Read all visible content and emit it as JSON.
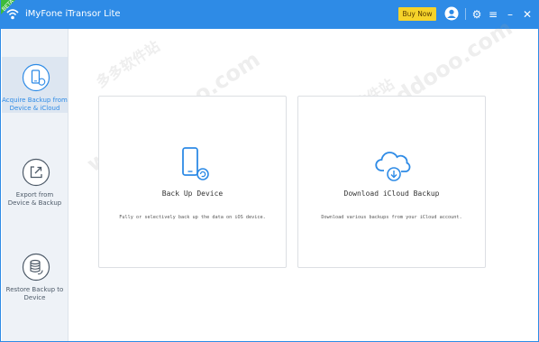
{
  "titlebar": {
    "corner_badge": "BETA",
    "title": "iMyFone iTransor Lite",
    "buy_label": "Buy Now",
    "icons": [
      "avatar-icon",
      "gear-icon",
      "menu-icon",
      "minimize-icon",
      "close-icon"
    ],
    "settings_glyph": "⚙",
    "menu_glyph": "≡",
    "minimize_glyph": "–",
    "close_glyph": "✕"
  },
  "sidebar": {
    "items": [
      {
        "label": "Acquire Backup from\nDevice & iCloud",
        "icon": "phone-restore-icon",
        "active": true
      },
      {
        "label": "Export from\nDevice & Backup",
        "icon": "export-icon",
        "active": false
      },
      {
        "label": "Restore Backup to\nDevice",
        "icon": "database-restore-icon",
        "active": false
      }
    ]
  },
  "cards": [
    {
      "title": "Back Up Device",
      "description": "Fully or selectively back up the data on iOS device.",
      "icon": "phone-backup-icon"
    },
    {
      "title": "Download iCloud Backup",
      "description": "Download various backups from your iCloud account.",
      "icon": "cloud-download-icon"
    }
  ],
  "watermark": {
    "domain": "www.ddooo.com",
    "cn": "多多软件站"
  },
  "colors": {
    "accent": "#2e8be6",
    "buy": "#f6d32a",
    "sidebar": "#eef2f7"
  }
}
